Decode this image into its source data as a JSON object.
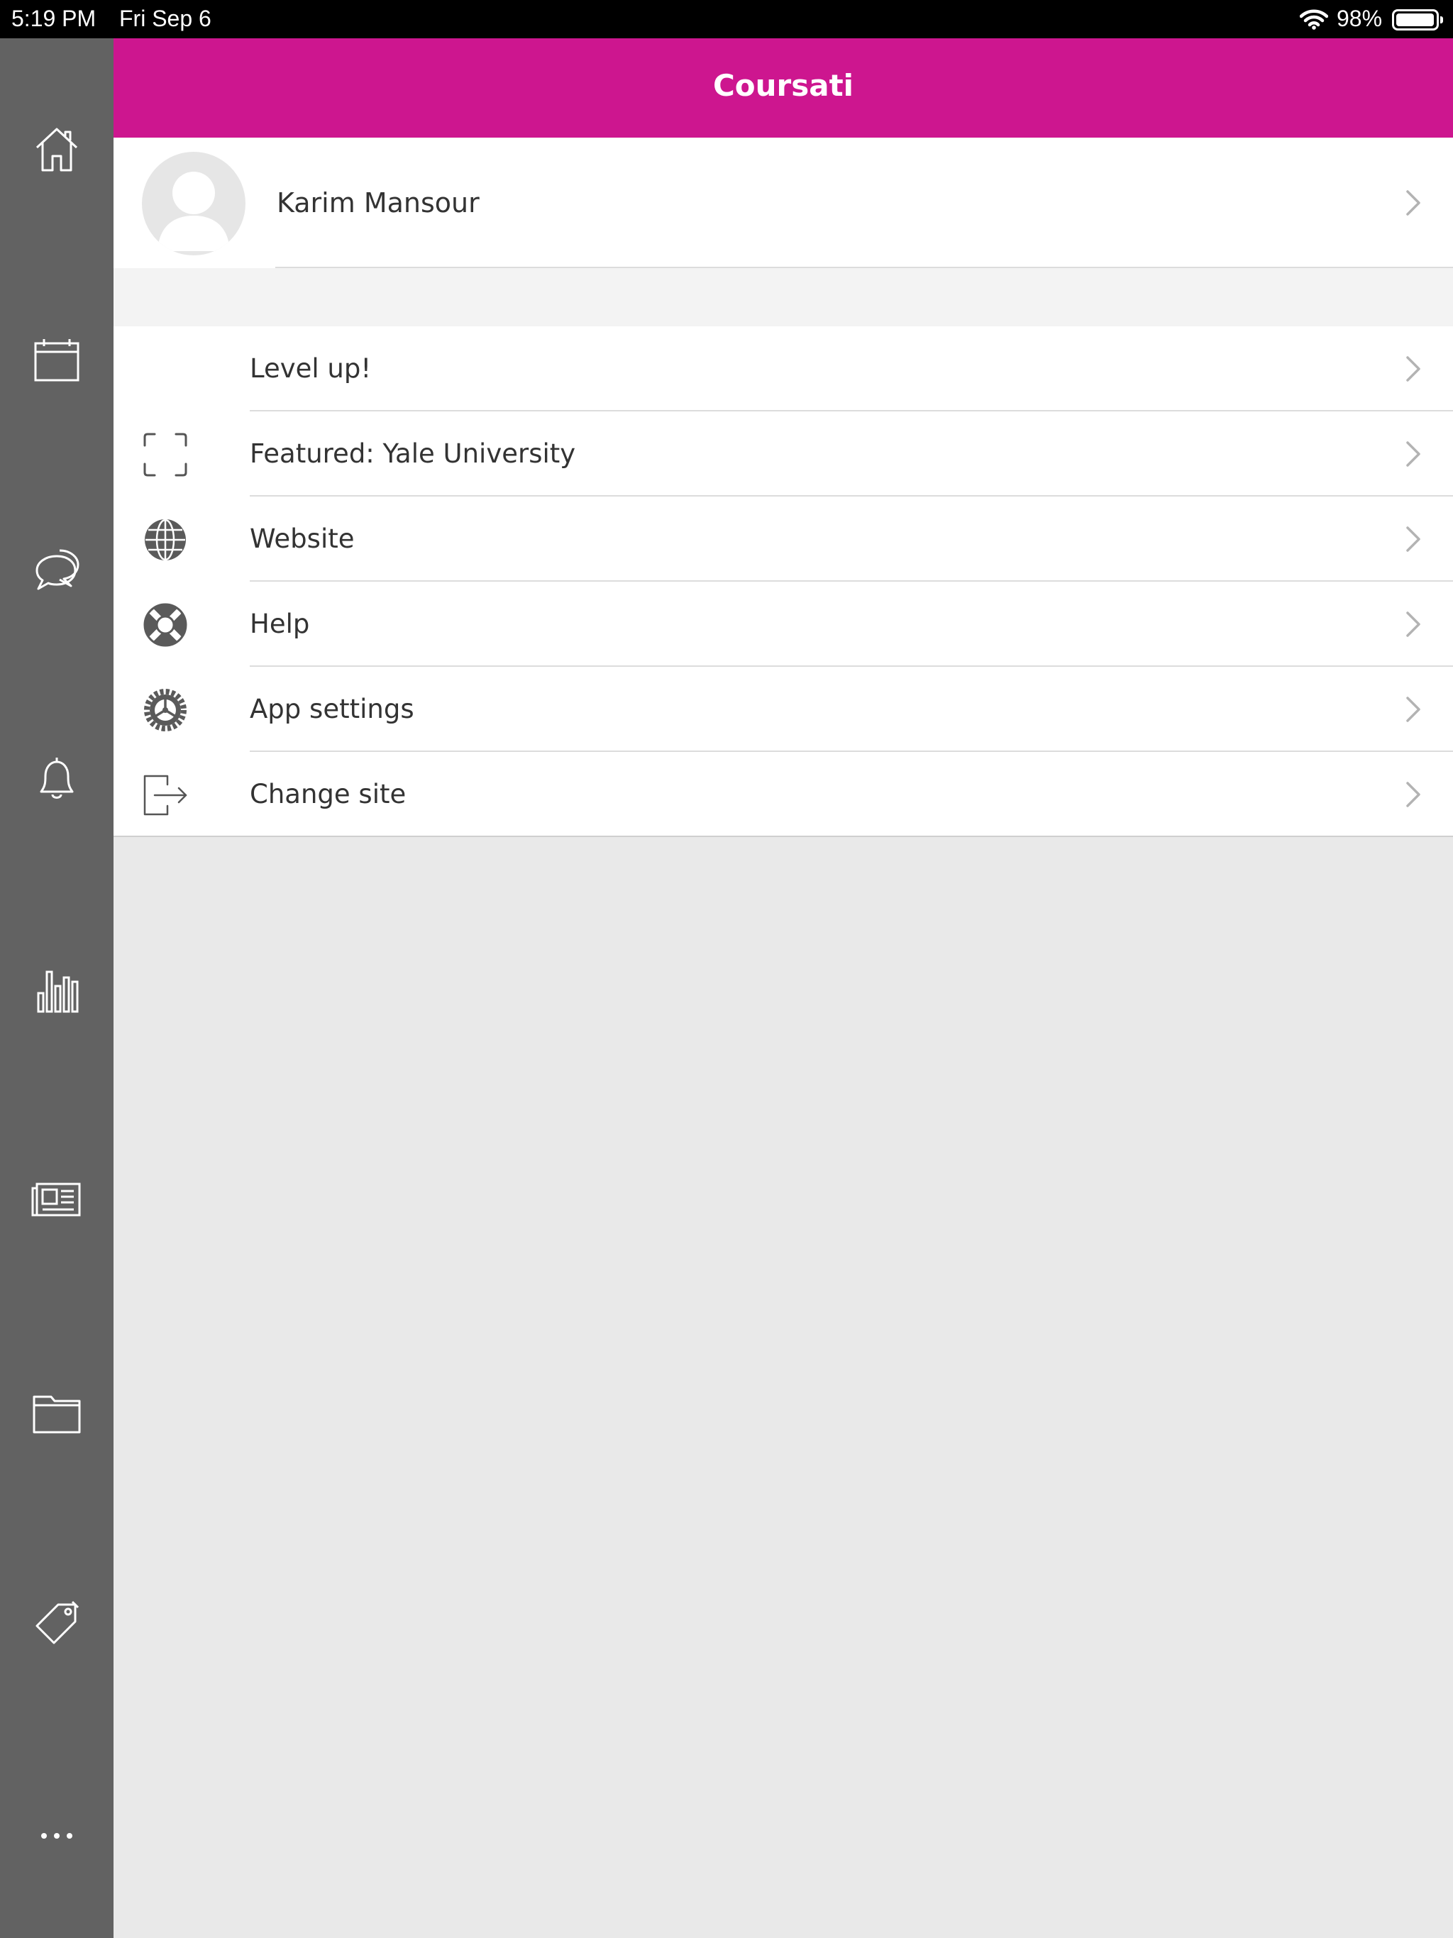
{
  "status_bar": {
    "time": "5:19 PM",
    "date": "Fri Sep 6",
    "battery": "98%",
    "battery_level": 0.98
  },
  "header": {
    "title": "Coursati"
  },
  "profile": {
    "name": "Karim Mansour"
  },
  "sidenav": {
    "items": [
      {
        "icon": "home-icon"
      },
      {
        "icon": "calendar-icon"
      },
      {
        "icon": "messages-icon"
      },
      {
        "icon": "notifications-icon"
      },
      {
        "icon": "grades-icon"
      },
      {
        "icon": "news-icon"
      },
      {
        "icon": "folder-icon"
      },
      {
        "icon": "tag-icon"
      },
      {
        "icon": "more-icon"
      }
    ]
  },
  "menu": {
    "items": [
      {
        "label": "Level up!",
        "icon": "none"
      },
      {
        "label": "Featured: Yale University",
        "icon": "scan-frame-icon"
      },
      {
        "label": "Website",
        "icon": "globe-icon"
      },
      {
        "label": "Help",
        "icon": "lifebuoy-icon"
      },
      {
        "label": "App settings",
        "icon": "gear-icon"
      },
      {
        "label": "Change site",
        "icon": "logout-icon"
      }
    ]
  },
  "colors": {
    "accent": "#cd168f",
    "sidebar": "#626262",
    "background": "#e9e9e9"
  }
}
